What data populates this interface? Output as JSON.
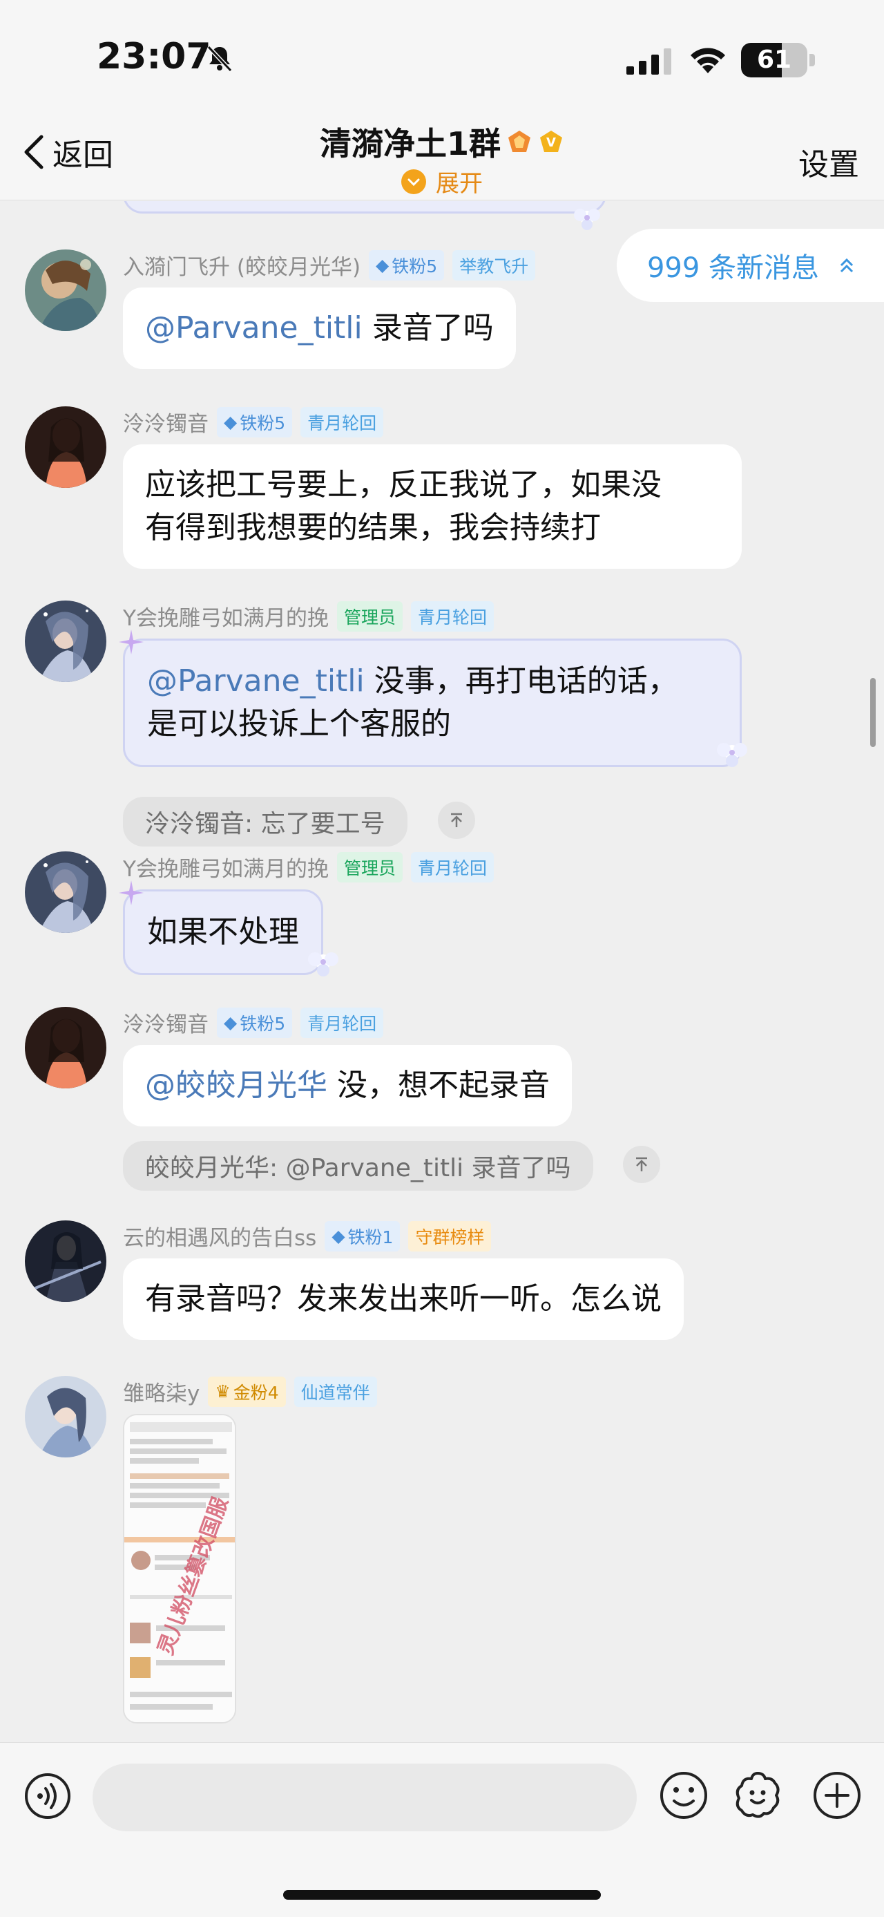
{
  "status": {
    "time": "23:07",
    "battery": "61",
    "battery_level": 0.61
  },
  "nav": {
    "back_label": "返回",
    "title": "清漪净土1群",
    "expand_label": "展开",
    "settings_label": "设置"
  },
  "new_messages": {
    "label": "999 条新消息"
  },
  "messages": [
    {
      "sender": "入漪门飞升 (皎皎月光华)",
      "tags": [
        "铁粉5",
        "举教飞升"
      ],
      "text_mention": "@Parvane_titli",
      "text": " 录音了吗"
    },
    {
      "sender": "泠泠镯音",
      "tags": [
        "铁粉5",
        "青月轮回"
      ],
      "line1": "应该把工号要上，反正我说了，如果没",
      "line2": "有得到我想要的结果，我会持续打"
    },
    {
      "sender": "Y会挽雕弓如满月的挽",
      "tags": [
        "管理员",
        "青月轮回"
      ],
      "text_mention": "@Parvane_titli",
      "line1": " 没事，再打电话的话，",
      "line2": "是可以投诉上个客服的",
      "quote": "泠泠镯音: 忘了要工号"
    },
    {
      "sender": "Y会挽雕弓如满月的挽",
      "tags": [
        "管理员",
        "青月轮回"
      ],
      "text": "如果不处理"
    },
    {
      "sender": "泠泠镯音",
      "tags": [
        "铁粉5",
        "青月轮回"
      ],
      "text_mention": "@皎皎月光华",
      "text": " 没，想不起录音",
      "quote": "皎皎月光华: @Parvane_titli 录音了吗"
    },
    {
      "sender": "云的相遇风的告白ss",
      "tags": [
        "铁粉1",
        "守群榜样"
      ],
      "text": "有录音吗？发来发出来听一听。怎么说"
    },
    {
      "sender": "雏略柒y",
      "tags": [
        "金粉4",
        "仙道常伴"
      ],
      "image_caption": "灵儿粉丝篡改国服"
    }
  ],
  "colors": {
    "accent_blue": "#3a96e0",
    "mention_blue": "#4a7ab8",
    "expand_orange": "#e58a16",
    "admin_green": "#19a55b"
  },
  "icons": [
    "bell-muted-icon",
    "signal-icon",
    "wifi-icon",
    "battery-icon",
    "back-chevron-icon",
    "vip-badge-icon",
    "chevron-down-icon",
    "double-chevron-up-icon",
    "arrow-up-icon",
    "voice-icon",
    "emoji-icon",
    "sticker-icon",
    "plus-icon"
  ]
}
